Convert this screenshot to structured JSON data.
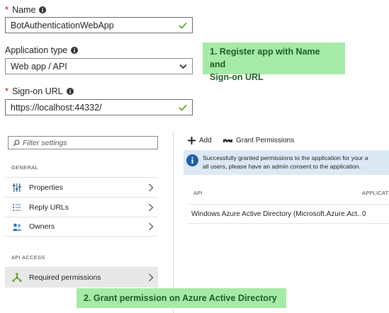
{
  "form": {
    "name": {
      "label": "Name",
      "required": true,
      "value": "BotAuthenticationWebApp"
    },
    "app_type": {
      "label": "Application type",
      "value": "Web app / API"
    },
    "signon": {
      "label": "Sign-on URL",
      "required": true,
      "value": "https://localhost:44332/"
    }
  },
  "callouts": {
    "step1_line1": "1. Register app with Name and",
    "step1_line2": "Sign-on URL",
    "step2": "2. Grant permission on Azure Active Directory"
  },
  "settings": {
    "filter_placeholder": "Filter settings",
    "general_header": "GENERAL",
    "api_access_header": "API ACCESS",
    "items": [
      {
        "label": "Properties",
        "icon": "properties-icon"
      },
      {
        "label": "Reply URLs",
        "icon": "list-icon"
      },
      {
        "label": "Owners",
        "icon": "people-icon"
      }
    ],
    "required_permissions": {
      "label": "Required permissions",
      "icon": "permissions-icon"
    }
  },
  "permissions_panel": {
    "add_label": "Add",
    "grant_label": "Grant Permissions",
    "info_line1": "Successfully granted permissions to the application for your a",
    "info_line2": "all users, please have an admin consent to the application.",
    "col_api": "API",
    "col_app": "APPLICAT",
    "row_api": "Windows Azure Active Directory (Microsoft.Azure.Act...",
    "row_count": "0"
  },
  "colors": {
    "callout_bg": "#a6eaa8",
    "info_bg": "#dce9f5",
    "required": "#c00000",
    "check": "#5fa624"
  }
}
